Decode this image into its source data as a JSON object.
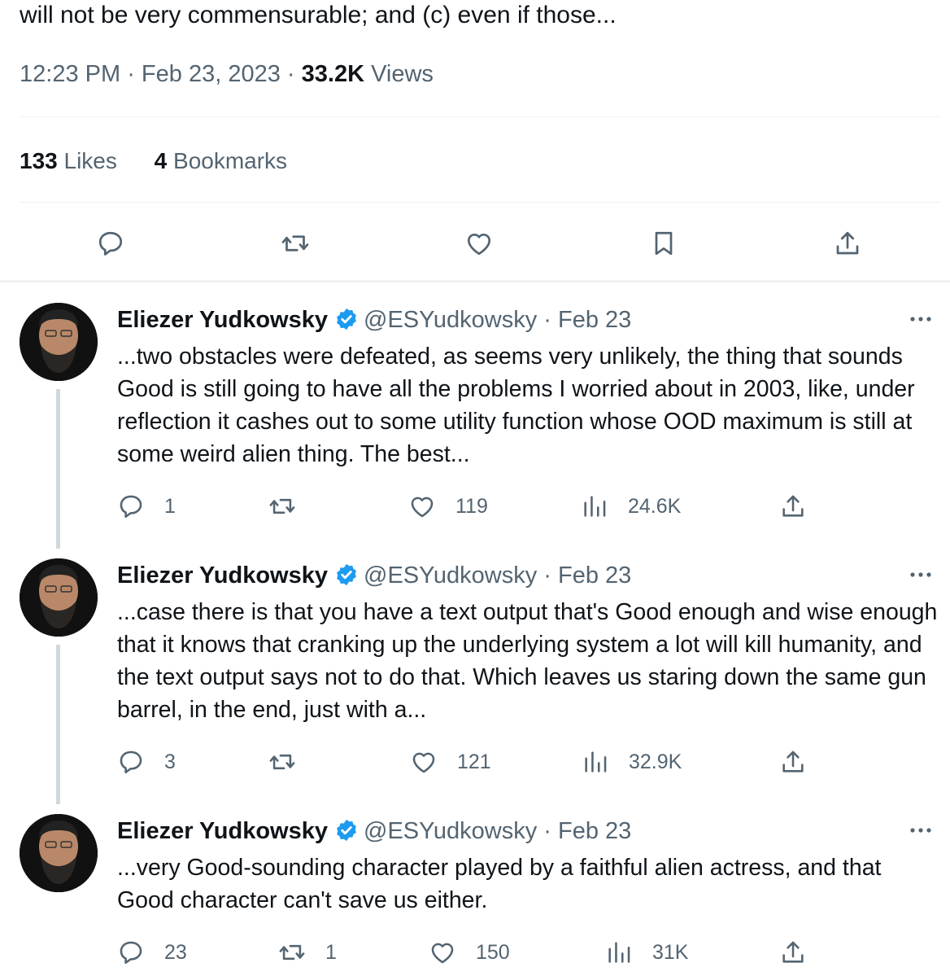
{
  "main_tweet": {
    "text_tail": "will not be very commensurable; and (c) even if those...",
    "time": "12:23 PM",
    "date": "Feb 23, 2023",
    "views_count": "33.2K",
    "views_label": "Views",
    "likes_count": "133",
    "likes_label": "Likes",
    "bookmarks_count": "4",
    "bookmarks_label": "Bookmarks"
  },
  "colors": {
    "text": "#0f1419",
    "secondary": "#536471",
    "verified": "#1d9bf0",
    "divider": "#eff3f4",
    "thread_line": "#cfd9de"
  },
  "replies": [
    {
      "name": "Eliezer Yudkowsky",
      "handle": "@ESYudkowsky",
      "date": "Feb 23",
      "text": "...two obstacles were defeated, as seems very unlikely, the thing that sounds Good is still going to have all the problems I worried about in 2003, like, under reflection it cashes out to some utility function whose OOD maximum is still at some weird alien thing.  The best...",
      "replies": "1",
      "retweets": "",
      "likes": "119",
      "views": "24.6K"
    },
    {
      "name": "Eliezer Yudkowsky",
      "handle": "@ESYudkowsky",
      "date": "Feb 23",
      "text": "...case there is that you have a text output that's Good enough and wise enough that it knows that cranking up the underlying system a lot will kill humanity, and the text output says not to do that.  Which leaves us staring down the same gun barrel, in the end, just with a...",
      "replies": "3",
      "retweets": "",
      "likes": "121",
      "views": "32.9K"
    },
    {
      "name": "Eliezer Yudkowsky",
      "handle": "@ESYudkowsky",
      "date": "Feb 23",
      "text": "...very Good-sounding character played by a faithful alien actress, and that Good character can't save us either.",
      "replies": "23",
      "retweets": "1",
      "likes": "150",
      "views": "31K"
    }
  ]
}
